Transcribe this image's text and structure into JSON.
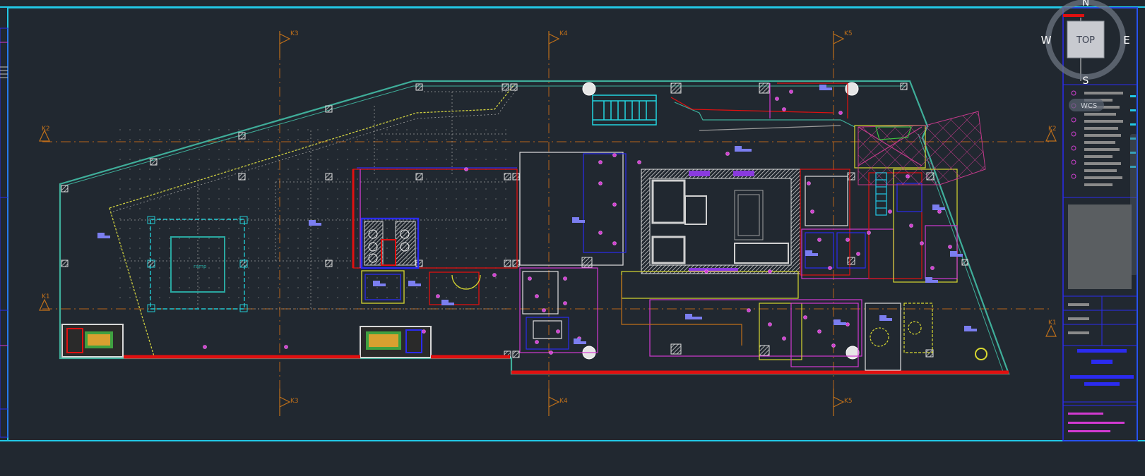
{
  "view_cube": {
    "top_label": "TOP",
    "north": "N",
    "south": "S",
    "east": "E",
    "west": "W",
    "ucs_label": "WCS"
  },
  "grid_markers": {
    "k1": "K1",
    "k2": "K2",
    "k3": "K3",
    "k4": "K4",
    "k5": "K5"
  },
  "colors": {
    "background": "#212830",
    "sheet_border": "#22c8e6",
    "wall_outline": "#3fae9a",
    "walls_white": "#d8d8d8",
    "accent_red": "#e01010",
    "accent_magenta": "#d23ad2",
    "accent_blue": "#2b2bf0",
    "accent_yellow": "#d8d830",
    "grid_axis": "#c0701a",
    "title_block_blue": "#1818d0"
  }
}
